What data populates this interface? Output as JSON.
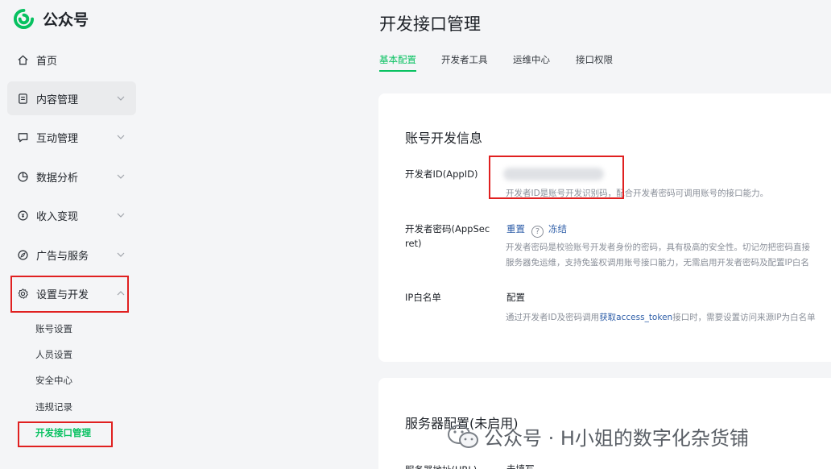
{
  "brand": {
    "name": "公众号",
    "logo": "wechat-official-account-logo",
    "accent": "#07c160"
  },
  "sidebar": {
    "items": [
      {
        "label": "首页",
        "icon": "home-icon"
      },
      {
        "label": "内容管理",
        "icon": "document-icon"
      },
      {
        "label": "互动管理",
        "icon": "chat-icon"
      },
      {
        "label": "数据分析",
        "icon": "pie-chart-icon"
      },
      {
        "label": "收入变现",
        "icon": "coin-icon"
      },
      {
        "label": "广告与服务",
        "icon": "compass-icon"
      },
      {
        "label": "设置与开发",
        "icon": "gear-icon"
      }
    ],
    "sub_items": [
      {
        "label": "账号设置"
      },
      {
        "label": "人员设置"
      },
      {
        "label": "安全中心"
      },
      {
        "label": "违规记录"
      },
      {
        "label": "开发接口管理"
      }
    ]
  },
  "main": {
    "title": "开发接口管理",
    "tabs": [
      {
        "label": "基本配置"
      },
      {
        "label": "开发者工具"
      },
      {
        "label": "运维中心"
      },
      {
        "label": "接口权限"
      }
    ],
    "account_section": {
      "title": "账号开发信息",
      "appid": {
        "label": "开发者ID(AppID)",
        "desc": "开发者ID是账号开发识别码，配合开发者密码可调用账号的接口能力。"
      },
      "secret": {
        "label_line1": "开发者密码(AppSec",
        "label_line2": "ret)",
        "reset": "重置",
        "help": "?",
        "freeze": "冻结",
        "desc1": "开发者密码是校验账号开发者身份的密码，具有极高的安全性。切记勿把密码直接",
        "desc2": "服务器免运维，支持免鉴权调用账号接口能力，无需启用开发者密码及配置IP白名"
      },
      "ip": {
        "label": "IP白名单",
        "config": "配置",
        "desc_pre": "通过开发者ID及密码调用",
        "desc_link": "获取access_token",
        "desc_post": "接口时，需要设置访问来源IP为白名单"
      }
    },
    "server_section": {
      "title": "服务器配置(未启用)",
      "url_label": "服务器地址(URL)",
      "url_value": "未填写"
    }
  },
  "watermark": {
    "text": "公众号 · H小姐的数字化杂货铺"
  }
}
